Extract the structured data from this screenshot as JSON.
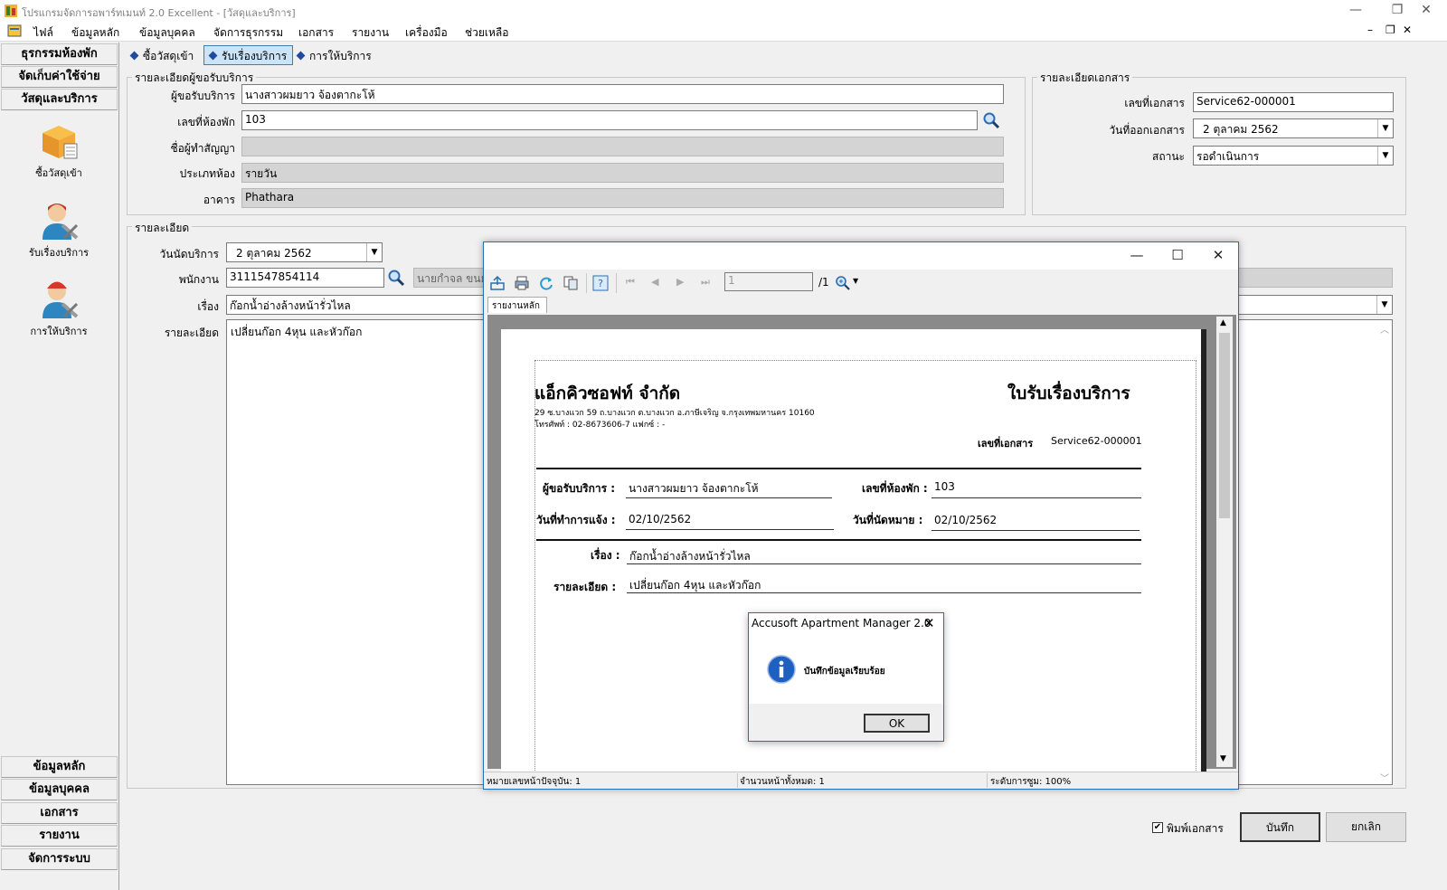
{
  "window": {
    "title": "โปรแกรมจัดการอพาร์ทเมนท์ 2.0 Excellent - [วัสดุและบริการ]",
    "controls": [
      "—",
      "❐",
      "✕"
    ]
  },
  "menu": [
    "ไฟล์",
    "ข้อมูลหลัก",
    "ข้อมูลบุคคล",
    "จัดการธุรกรรม",
    "เอกสาร",
    "รายงาน",
    "เครื่องมือ",
    "ช่วยเหลือ"
  ],
  "mdi_controls": [
    "–",
    "❐",
    "✕"
  ],
  "sidebar": {
    "top_buttons": [
      "ธุรกรรมห้องพัก",
      "จัดเก็บค่าใช้จ่าย",
      "วัสดุและบริการ"
    ],
    "items": [
      {
        "label": "ซื้อวัสดุเข้า",
        "icon": "box-icon"
      },
      {
        "label": "รับเรื่องบริการ",
        "icon": "service-person-icon"
      },
      {
        "label": "การให้บริการ",
        "icon": "technician-icon"
      }
    ],
    "bottom_buttons": [
      "ข้อมูลหลัก",
      "ข้อมูลบุคคล",
      "เอกสาร",
      "รายงาน",
      "จัดการระบบ"
    ]
  },
  "tabs": [
    "ซื้อวัสดุเข้า",
    "รับเรื่องบริการ",
    "การให้บริการ"
  ],
  "requester": {
    "group_title": "รายละเอียดผู้ขอรับบริการ",
    "requester_label": "ผู้ขอรับบริการ",
    "requester_value": "นางสาวผมยาว จ้องตากะโห้",
    "room_label": "เลขที่ห้องพัก",
    "room_value": "103",
    "contract_label": "ชื่อผู้ทำสัญญา",
    "contract_value": "",
    "roomtype_label": "ประเภทห้อง",
    "roomtype_value": "รายวัน",
    "building_label": "อาคาร",
    "building_value": "Phathara"
  },
  "document": {
    "group_title": "รายละเอียดเอกสาร",
    "docno_label": "เลขที่เอกสาร",
    "docno_value": "Service62-000001",
    "date_label": "วันที่ออกเอกสาร",
    "date_value": "2   ตุลาคม     2562",
    "status_label": "สถานะ",
    "status_value": "รอดำเนินการ"
  },
  "details": {
    "group_title": "รายละเอียด",
    "appt_label": "วันนัดบริการ",
    "appt_value": "2   ตุลาคม     2562",
    "staff_label": "พนักงาน",
    "staff_id": "3111547854114",
    "staff_name": "นายกำจล ขนย",
    "subject_label": "เรื่อง",
    "subject_value": "ก๊อกน้ำอ่างล้างหน้ารั่วไหล",
    "desc_label": "รายละเอียด",
    "desc_value": "เปลี่ยนก๊อก 4หุน และหัวก๊อก"
  },
  "footer": {
    "print_checkbox_label": "พิมพ์เอกสาร",
    "print_checked": true,
    "save_button": "บันทึก",
    "cancel_button": "ยกเลิก"
  },
  "report_viewer": {
    "controls": [
      "—",
      "☐",
      "✕"
    ],
    "page_input": "1",
    "page_total": "/1",
    "tab_label": "รายงานหลัก",
    "status": {
      "current_page": "หมายเลขหน้าปัจจุบัน: 1",
      "total_pages": "จำนวนหน้าทั้งหมด: 1",
      "zoom": "ระดับการซูม: 100%"
    },
    "report": {
      "company": "แอ็กคิวซอฟท์ จำกัด",
      "address": "29 ซ.บางแวก 59 ถ.บางแวก ต.บางแวก อ.ภาษีเจริญ จ.กรุงเทพมหานคร 10160",
      "phone": "โทรศัพท์ : 02-8673606-7 แฟกซ์ : -",
      "doc_title": "ใบรับเรื่องบริการ",
      "docno_label": "เลขที่เอกสาร",
      "docno_value": "Service62-000001",
      "requester_label": "ผู้ขอรับบริการ :",
      "requester_value": "นางสาวผมยาว จ้องตากะโห้",
      "room_label": "เลขที่ห้องพัก :",
      "room_value": "103",
      "notify_label": "วันที่ทำการแจ้ง :",
      "notify_value": "02/10/2562",
      "appt_label": "วันที่นัดหมาย :",
      "appt_value": "02/10/2562",
      "subject_label": "เรื่อง :",
      "subject_value": "ก๊อกน้ำอ่างล้างหน้ารั่วไหล",
      "desc_label": "รายละเอียด :",
      "desc_value": "เปลี่ยนก๊อก  4หุน และหัวก๊อก"
    }
  },
  "message_box": {
    "title": "Accusoft Apartment Manager 2.0",
    "message": "บันทึกข้อมูลเรียบร้อย",
    "ok_button": "OK"
  }
}
